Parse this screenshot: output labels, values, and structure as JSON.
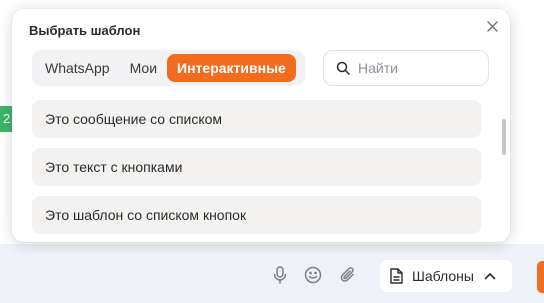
{
  "popup": {
    "title": "Выбрать шаблон",
    "tabs": [
      {
        "label": "WhatsApp",
        "active": false
      },
      {
        "label": "Мои",
        "active": false
      },
      {
        "label": "Интерактивные",
        "active": true
      }
    ],
    "search_placeholder": "Найти",
    "items": [
      {
        "label": "Это сообщение со списком"
      },
      {
        "label": "Это текст с кнопками"
      },
      {
        "label": "Это шаблон со списком кнопок"
      }
    ]
  },
  "background": {
    "side_tab_text": "2"
  },
  "toolbar": {
    "templates_label": "Шаблоны",
    "icons": [
      "microphone-icon",
      "emoji-icon",
      "paperclip-icon",
      "document-icon",
      "chevron-up-icon"
    ]
  },
  "colors": {
    "accent": "#f36b1e",
    "item_bg": "#f3f2f0",
    "tabs_bg": "#f2f2f4",
    "bottom_bar_bg": "#eef1f7",
    "side_tab": "#3db56b"
  }
}
